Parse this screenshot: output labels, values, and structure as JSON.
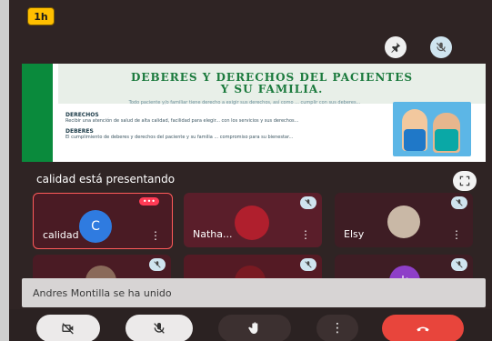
{
  "app": {
    "badge": "1h"
  },
  "slide": {
    "title_line1": "DEBERES Y DERECHOS DEL PACIENTES",
    "title_line2": "Y SU FAMILIA.",
    "subtitle": "Todo paciente y/o familiar tiene derecho a exigir sus derechos, así como ... cumplir con sus deberes...",
    "section1_heading": "DERECHOS",
    "section1_text": "Recibir una atención de salud de alta calidad, facilidad para elegir... con los servicios y sus derechos...",
    "section2_heading": "DEBERES",
    "section2_text": "El cumplimiento de deberes y derechos del paciente y su familia ... compromiso para su bienestar..."
  },
  "presenting": {
    "text": "calidad está presentando"
  },
  "participants": [
    {
      "name": "calidad",
      "initial": "C"
    },
    {
      "name": "Natha..."
    },
    {
      "name": "Elsy"
    },
    {
      "name": ""
    },
    {
      "name": ""
    },
    {
      "name": "",
      "initial": "k"
    }
  ],
  "toast": {
    "text": "Andres Montilla se ha unido"
  },
  "controls": {
    "more_label": "⋮"
  },
  "icons": {
    "pin": "pin-icon",
    "mute": "mic-off-icon",
    "expand": "expand-icon",
    "camera_off": "camera-off-icon",
    "mic_off": "mic-off-icon",
    "raise_hand": "hand-icon",
    "end_call": "phone-end-icon"
  },
  "colors": {
    "accent_red": "#e8453c",
    "tile_bg": "#5a1e2a",
    "badge": "#ffbf00",
    "slide_green": "#0a8a3c"
  }
}
